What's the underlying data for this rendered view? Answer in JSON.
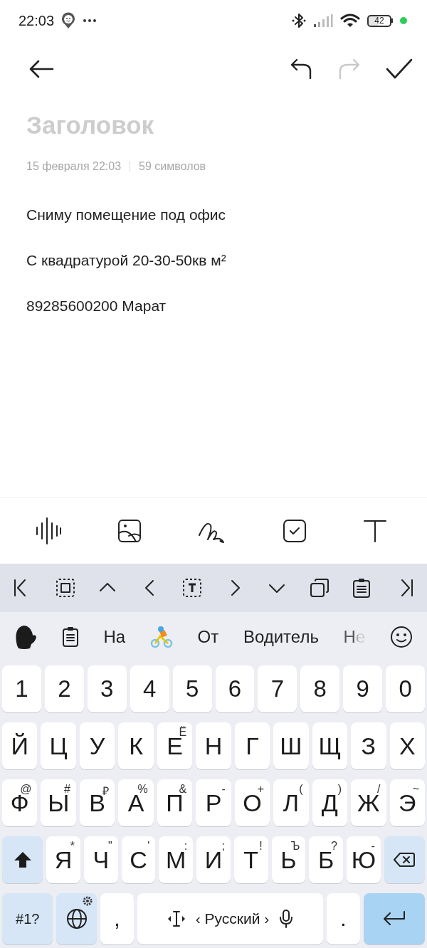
{
  "status_bar": {
    "time": "22:03",
    "battery": "42"
  },
  "header": {
    "undo": {
      "disabled": false
    },
    "redo": {
      "disabled": true
    }
  },
  "note": {
    "title_placeholder": "Заголовок",
    "date": "15 февраля 22:03",
    "char_count": "59 символов",
    "paragraphs": [
      "Сниму помещение под офис",
      "С квадратурой 20-30-50кв м²",
      "89285600200 Марат"
    ]
  },
  "suggestions": [
    {
      "kind": "word",
      "text": "На",
      "faded": false
    },
    {
      "kind": "picture"
    },
    {
      "kind": "word",
      "text": "От",
      "faded": false
    },
    {
      "kind": "word",
      "text": "Водитель",
      "faded": false
    },
    {
      "kind": "word",
      "text": "Не",
      "faded": true
    }
  ],
  "keyboard": {
    "number_row": [
      {
        "key": "1"
      },
      {
        "key": "2"
      },
      {
        "key": "3"
      },
      {
        "key": "4"
      },
      {
        "key": "5"
      },
      {
        "key": "6"
      },
      {
        "key": "7"
      },
      {
        "key": "8"
      },
      {
        "key": "9"
      },
      {
        "key": "0"
      }
    ],
    "top_row": [
      {
        "key": "Й"
      },
      {
        "key": "Ц"
      },
      {
        "key": "У"
      },
      {
        "key": "К"
      },
      {
        "key": "Е",
        "hint": "Ё"
      },
      {
        "key": "Н"
      },
      {
        "key": "Г"
      },
      {
        "key": "Ш"
      },
      {
        "key": "Щ"
      },
      {
        "key": "З"
      },
      {
        "key": "Х"
      }
    ],
    "middle_row": [
      {
        "key": "Ф",
        "hint": "@"
      },
      {
        "key": "Ы",
        "hint": "#"
      },
      {
        "key": "В",
        "hint": "₽"
      },
      {
        "key": "А",
        "hint": "%"
      },
      {
        "key": "П",
        "hint": "&"
      },
      {
        "key": "Р",
        "hint": "-"
      },
      {
        "key": "О",
        "hint": "+"
      },
      {
        "key": "Л",
        "hint": "("
      },
      {
        "key": "Д",
        "hint": ")"
      },
      {
        "key": "Ж",
        "hint": "/"
      },
      {
        "key": "Э",
        "hint": "~"
      }
    ],
    "bottom_row": [
      {
        "key": "Я",
        "hint": "*"
      },
      {
        "key": "Ч",
        "hint": "\""
      },
      {
        "key": "С",
        "hint": "'"
      },
      {
        "key": "М",
        "hint": ":"
      },
      {
        "key": "И",
        "hint": ";"
      },
      {
        "key": "Т",
        "hint": "!"
      },
      {
        "key": "Ь",
        "hint": "Ъ"
      },
      {
        "key": "Б",
        "hint": "?"
      },
      {
        "key": "Ю",
        "hint": "-"
      }
    ],
    "symbols_key": "#1?",
    "comma": ",",
    "language": "‹ Русский ›",
    "period": "."
  }
}
